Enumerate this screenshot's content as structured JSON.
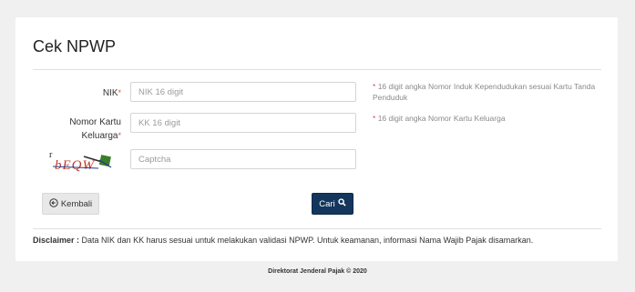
{
  "form": {
    "title": "Cek NPWP",
    "nik": {
      "label": "NIK",
      "required_mark": "*",
      "placeholder": "NIK 16 digit",
      "value": "",
      "hint_star": "*",
      "hint": "16 digit angka Nomor Induk Kependudukan sesuai Kartu Tanda Penduduk"
    },
    "kk": {
      "label_line1": "Nomor Kartu",
      "label_line2": "Keluarga",
      "required_mark": "*",
      "placeholder": "KK 16 digit",
      "value": "",
      "hint_star": "*",
      "hint": "16 digit angka Nomor Kartu Keluarga"
    },
    "captcha": {
      "image_text": "bEQW",
      "placeholder": "Captcha",
      "value": ""
    },
    "buttons": {
      "back_label": "Kembali",
      "back_icon": "circle-arrow-left-icon",
      "search_label": "Cari",
      "search_icon": "search-icon"
    },
    "disclaimer": {
      "heading": "Disclaimer :",
      "text": "Data NIK dan KK harus sesuai untuk melakukan validasi NPWP. Untuk keamanan, informasi Nama Wajib Pajak disamarkan."
    }
  },
  "footer": {
    "text": "Direktorat Jenderal Pajak © 2020"
  },
  "colors": {
    "primary_button": "#14365c",
    "required": "#d9534f",
    "background": "#f0f0f0"
  }
}
